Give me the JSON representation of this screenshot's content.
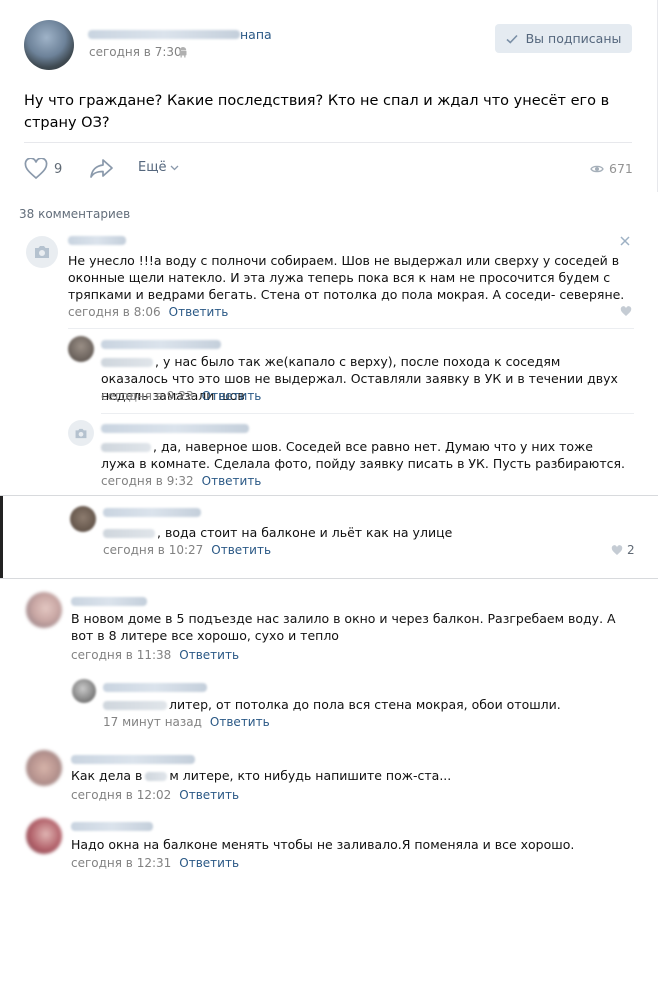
{
  "post": {
    "author_visible": "напа",
    "time": "сегодня в 7:30",
    "subscribed_label": "Вы подписаны",
    "text": "Ну что граждане? Какие последствия? Кто не спал и ждал что унесёт его в страну ОЗ?",
    "likes": "9",
    "more_label": "Ещё",
    "views": "671",
    "icons": [
      "android-icon",
      "check-icon",
      "heart-icon",
      "share-icon",
      "chevron-down-icon",
      "eye-icon"
    ]
  },
  "comments_count_label": "38 комментариев",
  "comments": [
    {
      "text": "Не унесло !!!а воду с полночи собираем. Шов не выдержал или сверху у соседей в оконные щели натекло. И эта лужа теперь пока вся к нам не просочится будем с тряпками и ведрами бегать. Стена от потолка до пола мокрая. А соседи- северяне.",
      "time": "сегодня в 8:06",
      "reply": "Ответить"
    },
    {
      "text": ", у нас было так же(капало с верху), после похода к соседям оказалось что это шов не выдержал. Оставляли заявку в УК и в течении двух недель замазали шов",
      "time": "сегодня в 9:23",
      "reply": "Ответить"
    },
    {
      "text": ", да, наверное шов. Соседей все равно нет. Думаю что у них тоже лужа в комнате. Сделала фото, пойду заявку писать в УК. Пусть разбираются.",
      "time": "сегодня в 9:32",
      "reply": "Ответить"
    },
    {
      "text": ", вода стоит на балконе и льёт как на улице",
      "time": "сегодня в 10:27",
      "reply": "Ответить",
      "likes": "2"
    },
    {
      "text": "В новом доме в 5 подъезде нас залило в окно и через балкон. Разгребаем воду. А вот в 8 литере все хорошо, сухо и тепло",
      "time": "сегодня в 11:38",
      "reply": "Ответить"
    },
    {
      "text": "литер, от потолка до пола вся стена мокрая, обои отошли.",
      "time": "17 минут назад",
      "reply": "Ответить"
    },
    {
      "text_a": "Как дела в",
      "text_b": "м литере, кто нибудь напишите пож-ста...",
      "time": "сегодня в 12:02",
      "reply": "Ответить"
    },
    {
      "text": "Надо окна на балконе менять чтобы не заливало.Я поменяла и все хорошо.",
      "time": "сегодня в 12:31",
      "reply": "Ответить"
    }
  ],
  "colors": {
    "link": "#2a5885",
    "meta": "#828282",
    "button_bg": "#e5ebf1"
  }
}
